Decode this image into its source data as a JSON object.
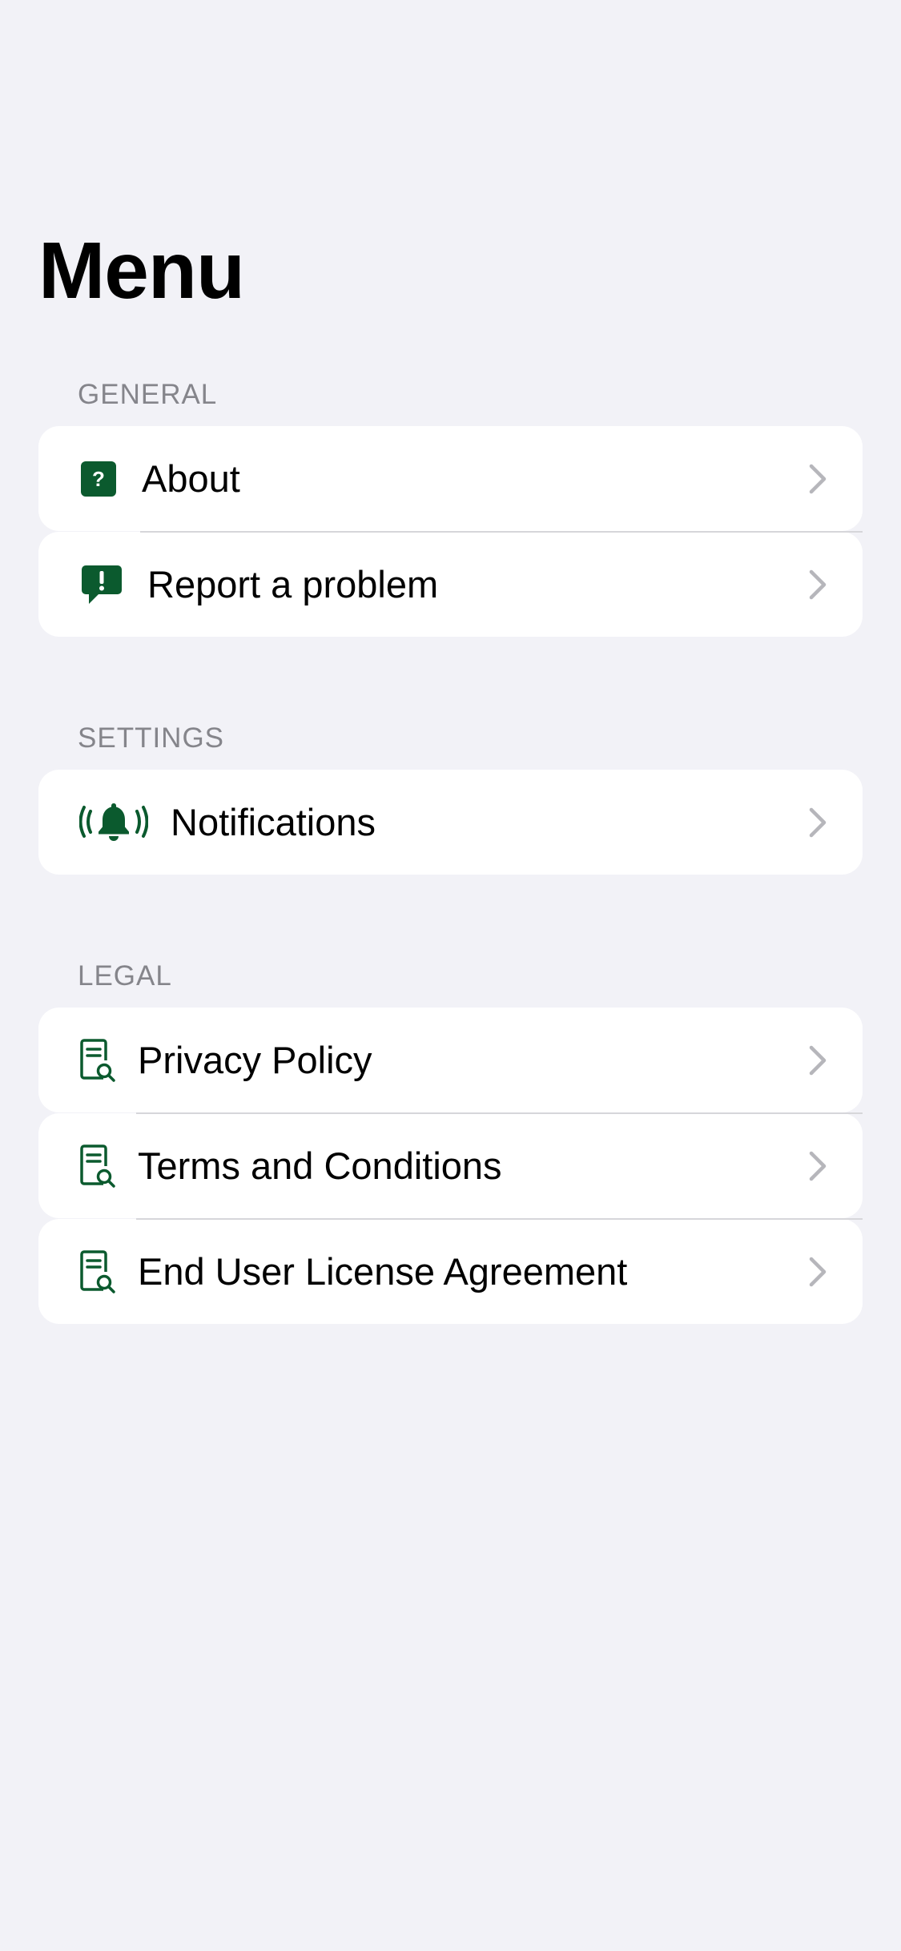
{
  "page": {
    "title": "Menu"
  },
  "colors": {
    "background": "#f2f2f7",
    "card": "#ffffff",
    "accent": "#0b5a2e",
    "section_header": "#85858b",
    "chevron": "#b6b6bb",
    "divider": "#d6d6da"
  },
  "sections": {
    "general": {
      "header": "GENERAL",
      "items": [
        {
          "label": "About",
          "icon": "question-square-icon"
        },
        {
          "label": "Report a problem",
          "icon": "exclamation-bubble-icon"
        }
      ]
    },
    "settings": {
      "header": "SETTINGS",
      "items": [
        {
          "label": "Notifications",
          "icon": "bell-ringing-icon"
        }
      ]
    },
    "legal": {
      "header": "LEGAL",
      "items": [
        {
          "label": "Privacy Policy",
          "icon": "document-search-icon"
        },
        {
          "label": "Terms and Conditions",
          "icon": "document-search-icon"
        },
        {
          "label": "End User License Agreement",
          "icon": "document-search-icon"
        }
      ]
    }
  }
}
